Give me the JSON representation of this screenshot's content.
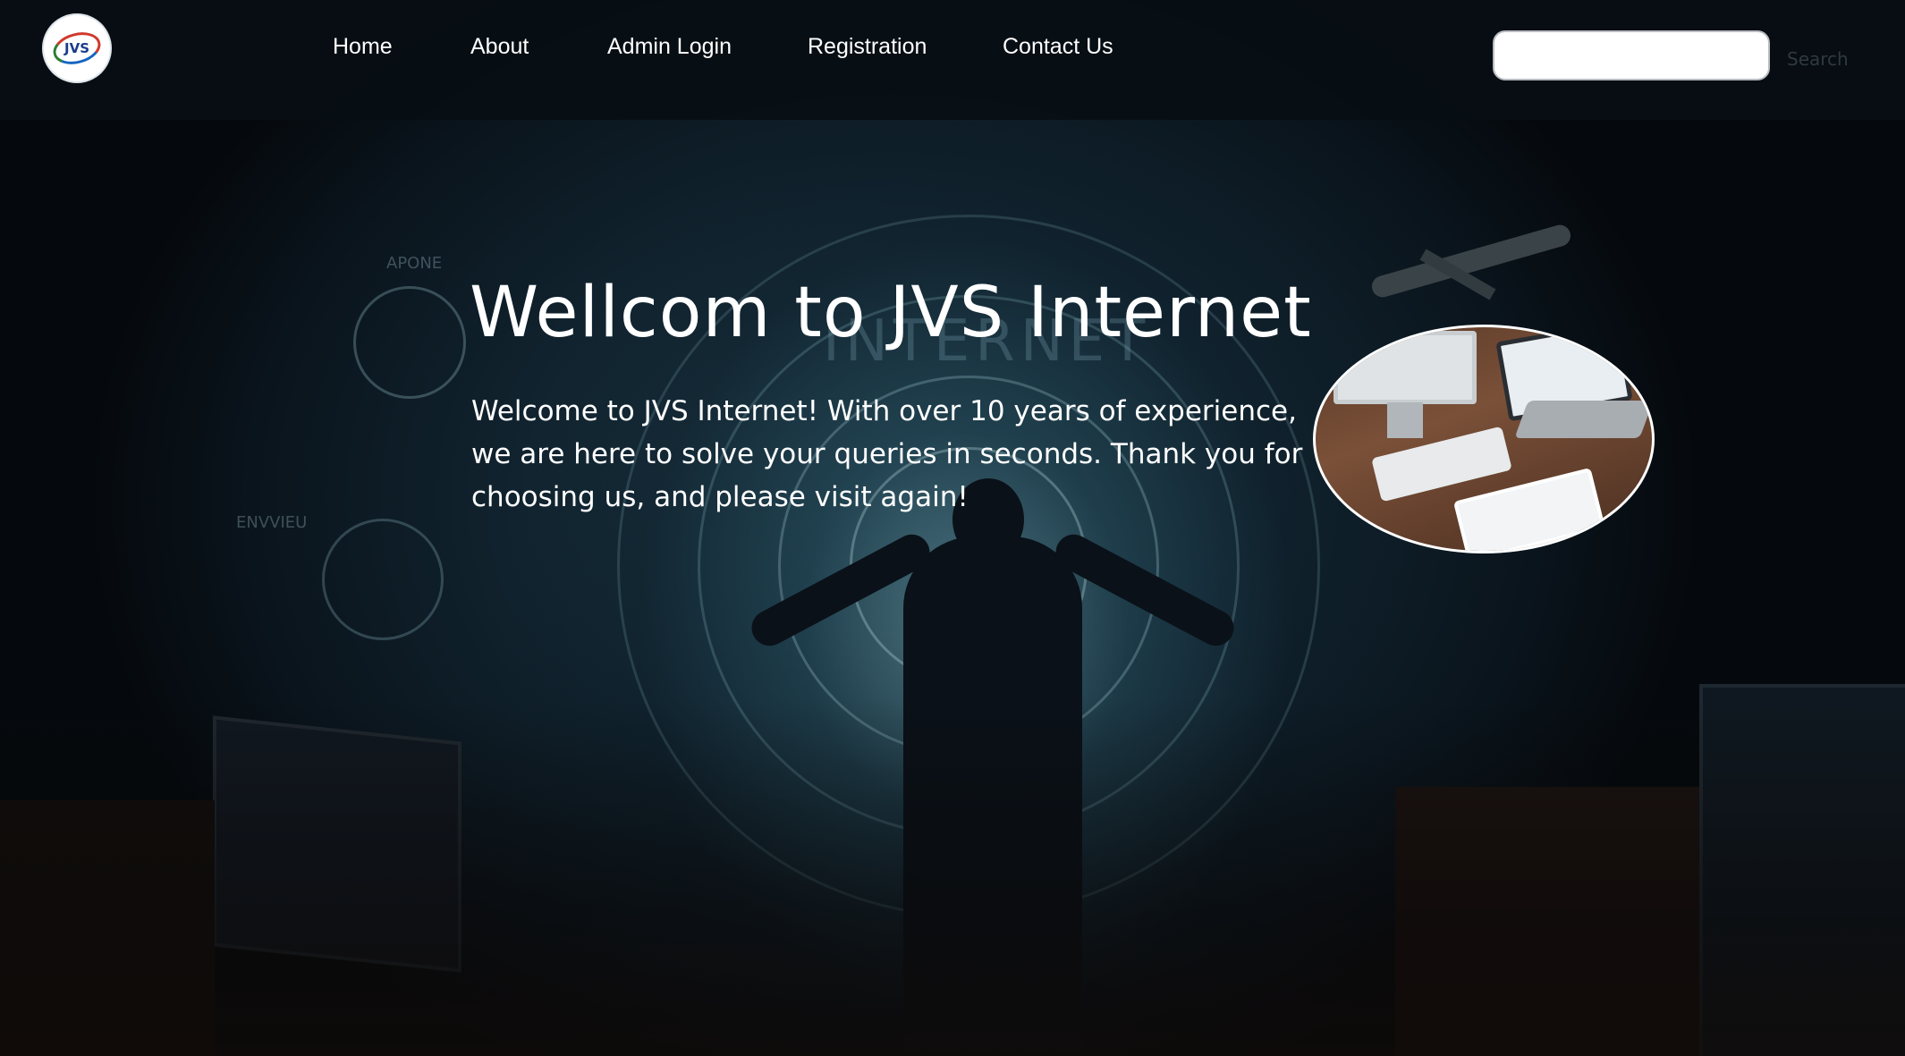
{
  "logo": {
    "text": "JVS"
  },
  "nav": {
    "items": [
      {
        "label": "Home"
      },
      {
        "label": "About"
      },
      {
        "label": "Admin Login"
      },
      {
        "label": "Registration"
      },
      {
        "label": "Contact Us"
      }
    ]
  },
  "search": {
    "value": "",
    "placeholder": "",
    "button_label": "Search"
  },
  "hero": {
    "title": "Wellcom to JVS Internet",
    "body": "Welcome to JVS Internet! With over 10 years of experience, we are here to solve your queries in seconds. Thank you for choosing us, and please visit again!"
  },
  "background_text": {
    "sign": "INTERNET",
    "gauge_top": "APONE",
    "gauge_left": "ENVVIEU"
  },
  "colors": {
    "nav_bg": "#080e14",
    "text": "#ffffff",
    "accent_glow": "#78aab4"
  }
}
